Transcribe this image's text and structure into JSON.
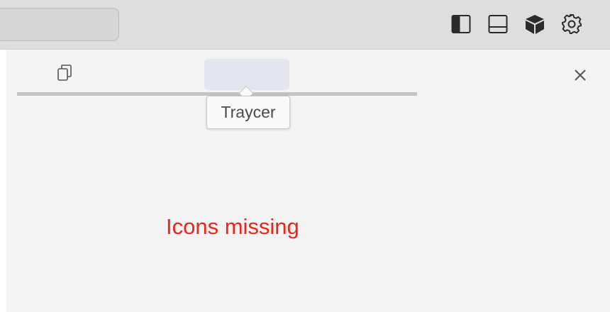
{
  "tooltip": {
    "text": "Traycer"
  },
  "annotation": {
    "text": "Icons missing",
    "color": "#e8261c"
  },
  "toolbar": {
    "icons": [
      "sidebar-left-icon",
      "panel-bottom-icon",
      "cube-icon",
      "gear-icon"
    ]
  },
  "panel": {
    "icons": [
      "copy-icon",
      "close-icon"
    ]
  },
  "colors": {
    "titlebar": "#dedede",
    "panel_background": "#f3f3f3",
    "tab_highlight": "#e4e6ef",
    "tab_underline": "#c2c2c2"
  }
}
